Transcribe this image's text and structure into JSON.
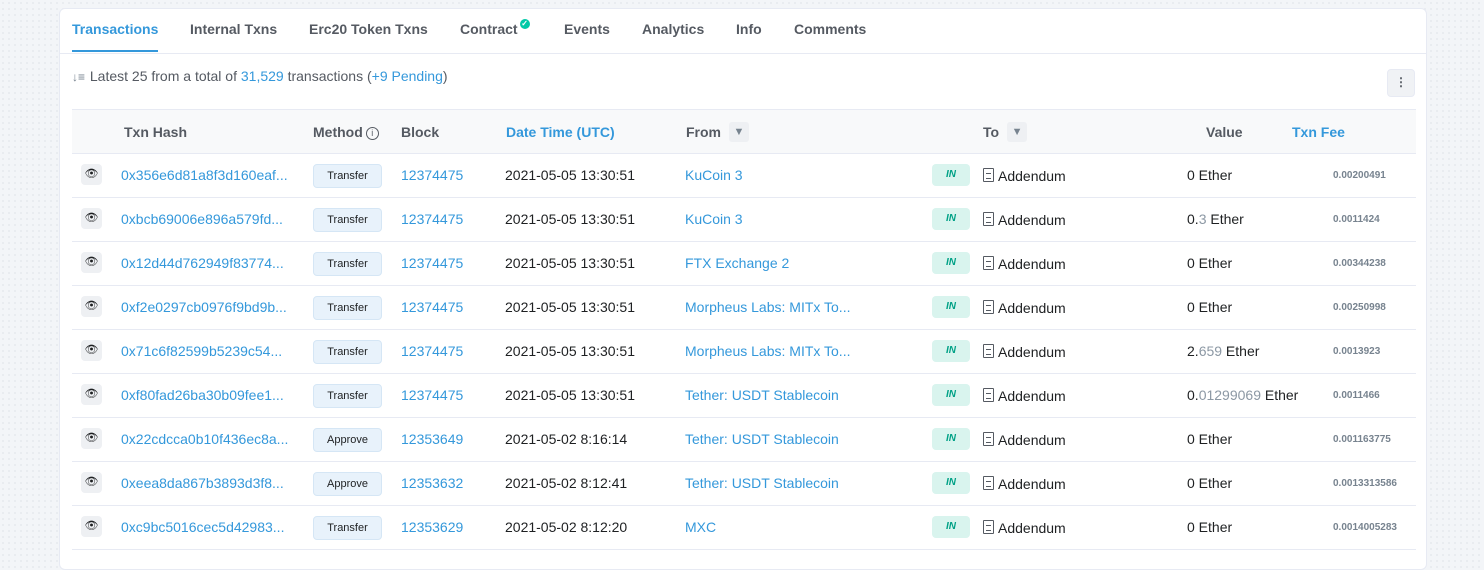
{
  "tabs": [
    {
      "label": "Transactions",
      "active": true
    },
    {
      "label": "Internal Txns"
    },
    {
      "label": "Erc20 Token Txns"
    },
    {
      "label": "Contract",
      "verified": true
    },
    {
      "label": "Events"
    },
    {
      "label": "Analytics"
    },
    {
      "label": "Info"
    },
    {
      "label": "Comments"
    }
  ],
  "summary": {
    "prefix": "Latest 25 from a total of",
    "count": "31,529",
    "middle": "transactions (",
    "pending": "+9 Pending",
    "suffix": ")"
  },
  "menu_icon": "more-vertical-icon",
  "columns": {
    "txn_hash": "Txn Hash",
    "method": "Method",
    "block": "Block",
    "date_time": "Date Time (UTC)",
    "from": "From",
    "to": "To",
    "value": "Value",
    "txn_fee": "Txn Fee"
  },
  "colors": {
    "accent": "#3498db",
    "in_badge_bg": "#d9f4ee",
    "in_badge_text": "#00a186"
  },
  "rows": [
    {
      "hash": "0x356e6d81a8f3d160eaf...",
      "method": "Transfer",
      "block": "12374475",
      "date": "2021-05-05 13:30:51",
      "from": "KuCoin 3",
      "direction": "IN",
      "to": "Addendum",
      "value_main": "0",
      "value_dim": "",
      "value_unit": " Ether",
      "fee": "0.00200491"
    },
    {
      "hash": "0xbcb69006e896a579fd...",
      "method": "Transfer",
      "block": "12374475",
      "date": "2021-05-05 13:30:51",
      "from": "KuCoin 3",
      "direction": "IN",
      "to": "Addendum",
      "value_main": "0.",
      "value_dim": "3",
      "value_unit": " Ether",
      "fee": "0.0011424"
    },
    {
      "hash": "0x12d44d762949f83774...",
      "method": "Transfer",
      "block": "12374475",
      "date": "2021-05-05 13:30:51",
      "from": "FTX Exchange 2",
      "direction": "IN",
      "to": "Addendum",
      "value_main": "0",
      "value_dim": "",
      "value_unit": " Ether",
      "fee": "0.00344238"
    },
    {
      "hash": "0xf2e0297cb0976f9bd9b...",
      "method": "Transfer",
      "block": "12374475",
      "date": "2021-05-05 13:30:51",
      "from": "Morpheus Labs: MITx To...",
      "direction": "IN",
      "to": "Addendum",
      "value_main": "0",
      "value_dim": "",
      "value_unit": " Ether",
      "fee": "0.00250998"
    },
    {
      "hash": "0x71c6f82599b5239c54...",
      "method": "Transfer",
      "block": "12374475",
      "date": "2021-05-05 13:30:51",
      "from": "Morpheus Labs: MITx To...",
      "direction": "IN",
      "to": "Addendum",
      "value_main": "2.",
      "value_dim": "659",
      "value_unit": " Ether",
      "fee": "0.0013923"
    },
    {
      "hash": "0xf80fad26ba30b09fee1...",
      "method": "Transfer",
      "block": "12374475",
      "date": "2021-05-05 13:30:51",
      "from": "Tether: USDT Stablecoin",
      "direction": "IN",
      "to": "Addendum",
      "value_main": "0.",
      "value_dim": "01299069",
      "value_unit": " Ether",
      "fee": "0.0011466"
    },
    {
      "hash": "0x22cdcca0b10f436ec8a...",
      "method": "Approve",
      "block": "12353649",
      "date": "2021-05-02 8:16:14",
      "from": "Tether: USDT Stablecoin",
      "direction": "IN",
      "to": "Addendum",
      "value_main": "0",
      "value_dim": "",
      "value_unit": " Ether",
      "fee": "0.001163775"
    },
    {
      "hash": "0xeea8da867b3893d3f8...",
      "method": "Approve",
      "block": "12353632",
      "date": "2021-05-02 8:12:41",
      "from": "Tether: USDT Stablecoin",
      "direction": "IN",
      "to": "Addendum",
      "value_main": "0",
      "value_dim": "",
      "value_unit": " Ether",
      "fee": "0.0013313586"
    },
    {
      "hash": "0xc9bc5016cec5d42983...",
      "method": "Transfer",
      "block": "12353629",
      "date": "2021-05-02 8:12:20",
      "from": "MXC",
      "direction": "IN",
      "to": "Addendum",
      "value_main": "0",
      "value_dim": "",
      "value_unit": " Ether",
      "fee": "0.0014005283"
    }
  ]
}
